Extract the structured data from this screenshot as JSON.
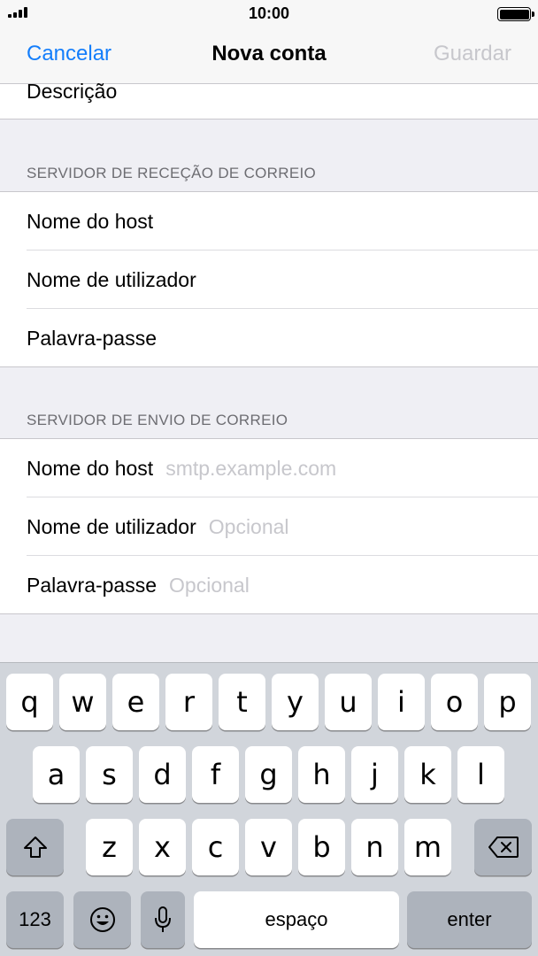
{
  "status_bar": {
    "time": "10:00"
  },
  "nav": {
    "cancel_label": "Cancelar",
    "title": "Nova conta",
    "save_label": "Guardar"
  },
  "form": {
    "description_label": "Descrição",
    "incoming": {
      "header": "SERVIDOR DE RECEÇÃO DE CORREIO",
      "host_label": "Nome do host",
      "user_label": "Nome de utilizador",
      "password_label": "Palavra-passe"
    },
    "outgoing": {
      "header": "SERVIDOR DE ENVIO DE CORREIO",
      "host_label": "Nome do host",
      "host_placeholder": "smtp.example.com",
      "user_label": "Nome de utilizador",
      "user_placeholder": "Opcional",
      "password_label": "Palavra-passe",
      "password_placeholder": "Opcional"
    }
  },
  "keyboard": {
    "row1": [
      "q",
      "w",
      "e",
      "r",
      "t",
      "y",
      "u",
      "i",
      "o",
      "p"
    ],
    "row2": [
      "a",
      "s",
      "d",
      "f",
      "g",
      "h",
      "j",
      "k",
      "l"
    ],
    "row3": [
      "z",
      "x",
      "c",
      "v",
      "b",
      "n",
      "m"
    ],
    "numbers_label": "123",
    "space_label": "espaço",
    "enter_label": "enter"
  }
}
